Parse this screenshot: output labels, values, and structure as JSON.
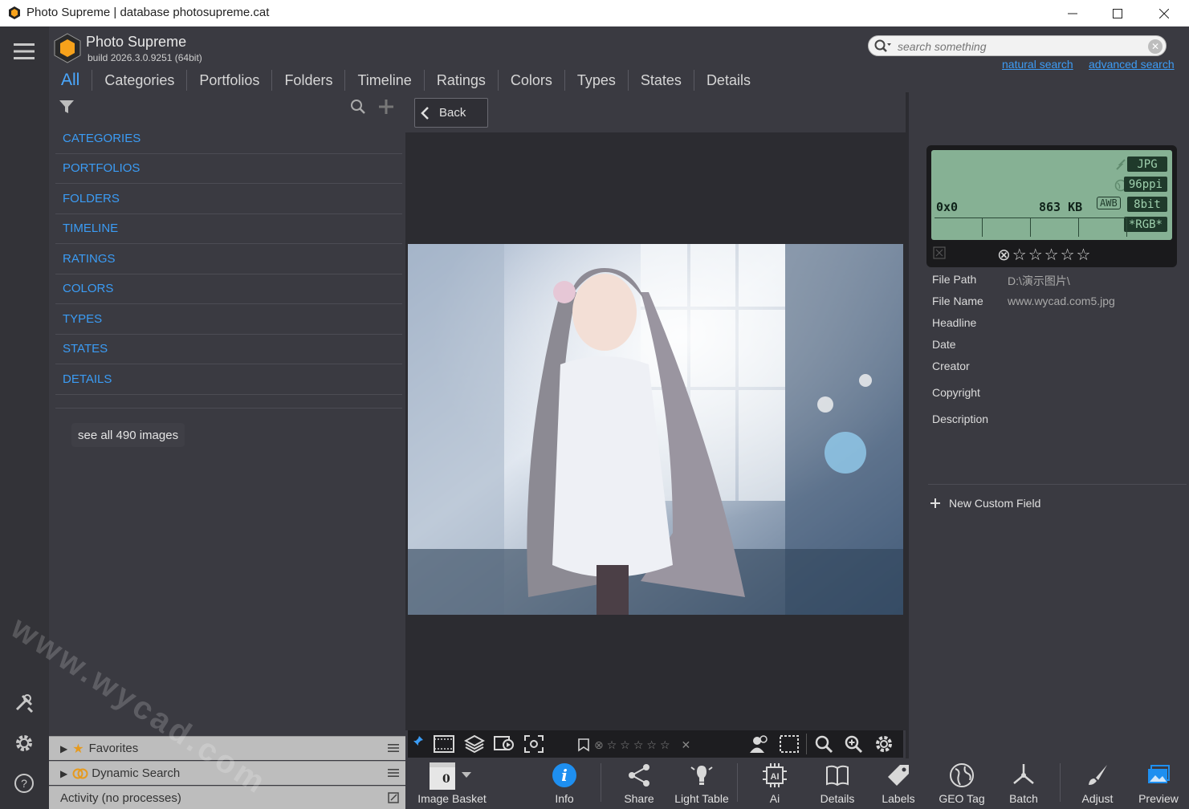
{
  "window": {
    "title": "Photo Supreme | database photosupreme.cat",
    "minimize": "—",
    "maximize": "☐",
    "close": "✕"
  },
  "header": {
    "app_name": "Photo Supreme",
    "build": "build 2026.3.0.9251 (64bit)",
    "tabs": [
      "All",
      "Categories",
      "Portfolios",
      "Folders",
      "Timeline",
      "Ratings",
      "Colors",
      "Types",
      "States",
      "Details"
    ],
    "search_placeholder": "search something",
    "natural_search": "natural search",
    "advanced_search": "advanced search"
  },
  "left_panel": {
    "categories": [
      "CATEGORIES",
      "PORTFOLIOS",
      "FOLDERS",
      "TIMELINE",
      "RATINGS",
      "COLORS",
      "TYPES",
      "STATES",
      "DETAILS"
    ],
    "see_all": "see all 490 images",
    "rows": {
      "favorites": "Favorites",
      "dynamic_search": "Dynamic Search",
      "activity": "Activity (no processes)"
    }
  },
  "center": {
    "back_label": "Back"
  },
  "right_panel": {
    "lcd": {
      "format": "JPG",
      "ppi": "96ppi",
      "awb": "AWB",
      "bit": "8bit",
      "color": "*RGB*",
      "dimensions": "0x0",
      "size": "863 KB"
    },
    "fields": [
      {
        "key": "File Path",
        "value": "D:\\演示图片\\"
      },
      {
        "key": "File Name",
        "value": "www.wycad.com5.jpg"
      },
      {
        "key": "Headline",
        "value": ""
      },
      {
        "key": "Date",
        "value": ""
      },
      {
        "key": "Creator",
        "value": ""
      },
      {
        "key": "Copyright",
        "value": ""
      },
      {
        "key": "Description",
        "value": ""
      }
    ],
    "new_custom_field": "New Custom Field"
  },
  "bottom_toolbar": {
    "basket_count": "0",
    "items": [
      "Image Basket",
      "Info",
      "Share",
      "Light Table",
      "Ai",
      "Details",
      "Labels",
      "GEO Tag",
      "Batch",
      "Adjust",
      "Preview"
    ]
  },
  "watermark": "www.wycad.com",
  "colors": {
    "accent": "#3b9cf5",
    "background": "#3a3a41",
    "lcd_green": "#86b194"
  }
}
